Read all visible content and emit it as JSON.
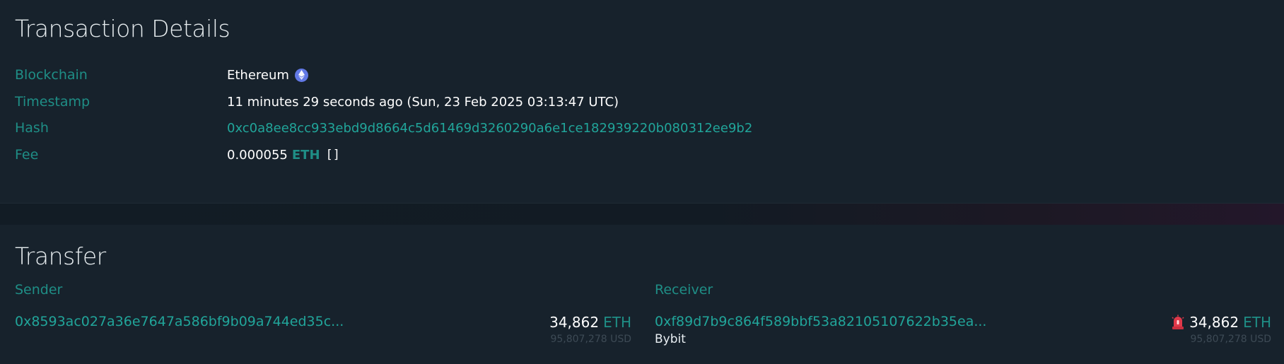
{
  "details": {
    "title": "Transaction Details",
    "rows": [
      {
        "label": "Blockchain",
        "value": "Ethereum",
        "icon": "ethereum-icon"
      },
      {
        "label": "Timestamp",
        "value": "11 minutes 29 seconds ago (Sun, 23 Feb 2025 03:13:47 UTC)"
      },
      {
        "label": "Hash",
        "value": "0xc0a8ee8cc933ebd9d8664c5d61469d3260290a6e1ce182939220b080312ee9b2"
      },
      {
        "label": "Fee",
        "value": "0.000055",
        "unit": "ETH",
        "icon": "copy-icon",
        "icon_glyph": "[]"
      }
    ]
  },
  "transfer": {
    "title": "Transfer",
    "sender": {
      "heading": "Sender",
      "address": "0x8593ac027a36e7647a586bf9b09a744ed35c...",
      "amount": "34,862",
      "unit": "ETH",
      "usd": "95,807,278 USD"
    },
    "receiver": {
      "heading": "Receiver",
      "address": "0xf89d7b9c864f589bbf53a82105107622b35ea...",
      "owner": "Bybit",
      "amount": "34,862",
      "unit": "ETH",
      "usd": "95,807,278 USD",
      "icon": "alert-siren-icon"
    }
  },
  "colors": {
    "background": "#17222c",
    "label": "#1f8e86",
    "link": "#21a59a",
    "text": "#ffffff",
    "muted": "#3d4a55",
    "eth_icon": "#6279e6",
    "alert": "#e0394a"
  }
}
